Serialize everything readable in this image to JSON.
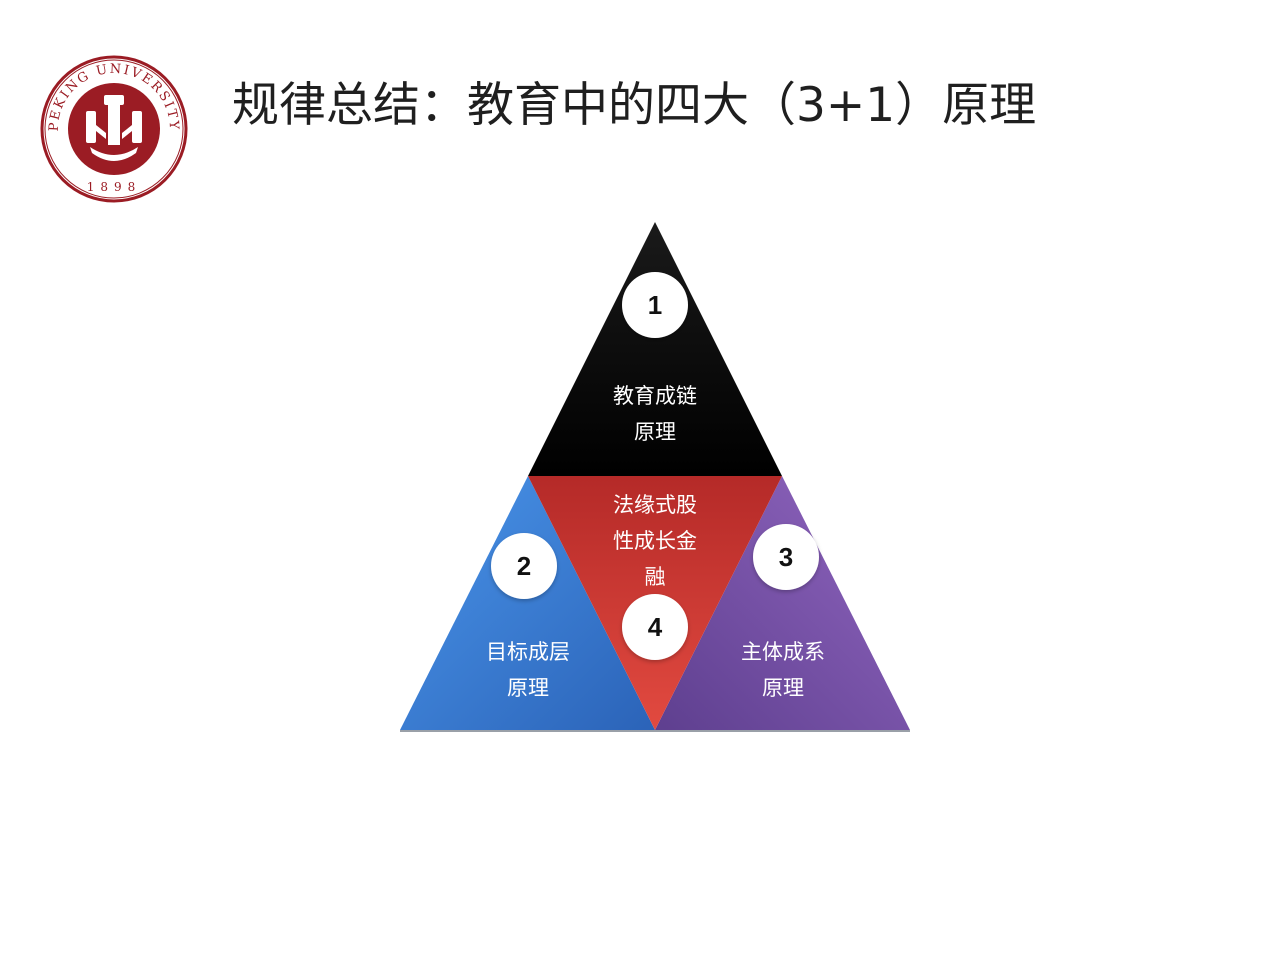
{
  "slide": {
    "title": "规律总结：教育中的四大（3+1）原理",
    "logo": {
      "ring_text": "PEKING UNIVERSITY",
      "year": "1898",
      "color": "#9b1c24"
    }
  },
  "diagram": {
    "segments": [
      {
        "id": "top",
        "badge": "1",
        "label_lines": [
          "教育成链",
          "原理"
        ],
        "color": "#000000"
      },
      {
        "id": "left",
        "badge": "2",
        "label_lines": [
          "目标成层",
          "原理"
        ],
        "color": "#3a7fd5"
      },
      {
        "id": "right",
        "badge": "3",
        "label_lines": [
          "主体成系",
          "原理"
        ],
        "color": "#7d55a8"
      },
      {
        "id": "center",
        "badge": "4",
        "label_lines": [
          "法缘式股",
          "性成长金",
          "融"
        ],
        "color": "#c8302c"
      }
    ]
  }
}
